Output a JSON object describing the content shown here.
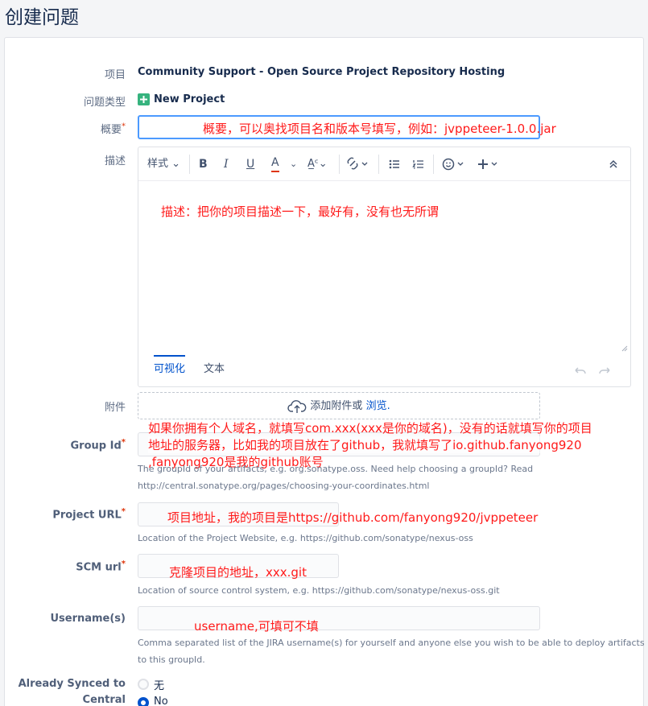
{
  "page_title": "创建问题",
  "fields": {
    "project": {
      "label": "项目",
      "value": "Community Support - Open Source Project Repository Hosting"
    },
    "issue_type": {
      "label": "问题类型",
      "value": "New Project"
    },
    "summary": {
      "label": "概要",
      "required_mark": "*",
      "annotation": "概要，可以奥找项目名和版本号填写，例如：jvppeteer-1.0.0.jar"
    },
    "description": {
      "label": "描述",
      "annotation": "描述：把你的项目描述一下，最好有，没有也无所谓"
    },
    "attachment": {
      "label": "附件",
      "text": "添加附件或",
      "link": "浏览."
    },
    "group_id": {
      "label": "Group Id",
      "required_mark": "*",
      "annotation_1": "如果你拥有个人域名，就填写com.xxx(xxx是你的域名)，没有的话就填写你的项目",
      "annotation_2": "地址的服务器，比如我的项目放在了github，我就填写了io.github.fanyong920",
      "annotation_3": ",fanyong920是我的github账号",
      "help_1": "The groupId of your artifacts, e.g. org.sonatype.oss. Need help choosing a groupId? Read",
      "help_2": "http://central.sonatype.org/pages/choosing-your-coordinates.html"
    },
    "project_url": {
      "label": "Project URL",
      "required_mark": "*",
      "annotation": "项目地址，我的项目是https://github.com/fanyong920/jvppeteer",
      "help": "Location of the Project Website, e.g. https://github.com/sonatype/nexus-oss"
    },
    "scm_url": {
      "label": "SCM url",
      "required_mark": "*",
      "annotation": "克隆项目的地址，xxx.git",
      "help": "Location of source control system, e.g. https://github.com/sonatype/nexus-oss.git"
    },
    "usernames": {
      "label": "Username(s)",
      "annotation": "username,可填可不填",
      "help_1": "Comma separated list of the JIRA username(s) for yourself and anyone else you wish to be able to deploy artifacts",
      "help_2": "to this groupId."
    },
    "already_synced": {
      "label_1": "Already Synced to",
      "label_2": "Central",
      "option_no_cn": "无",
      "option_no": "No",
      "selected": "No"
    }
  },
  "editor": {
    "style_label": "样式",
    "tab_visual": "可视化",
    "tab_text": "文本"
  },
  "colors": {
    "accent": "#0052cc",
    "annotation": "#ff1a1a",
    "add_icon": "#36b37e"
  }
}
